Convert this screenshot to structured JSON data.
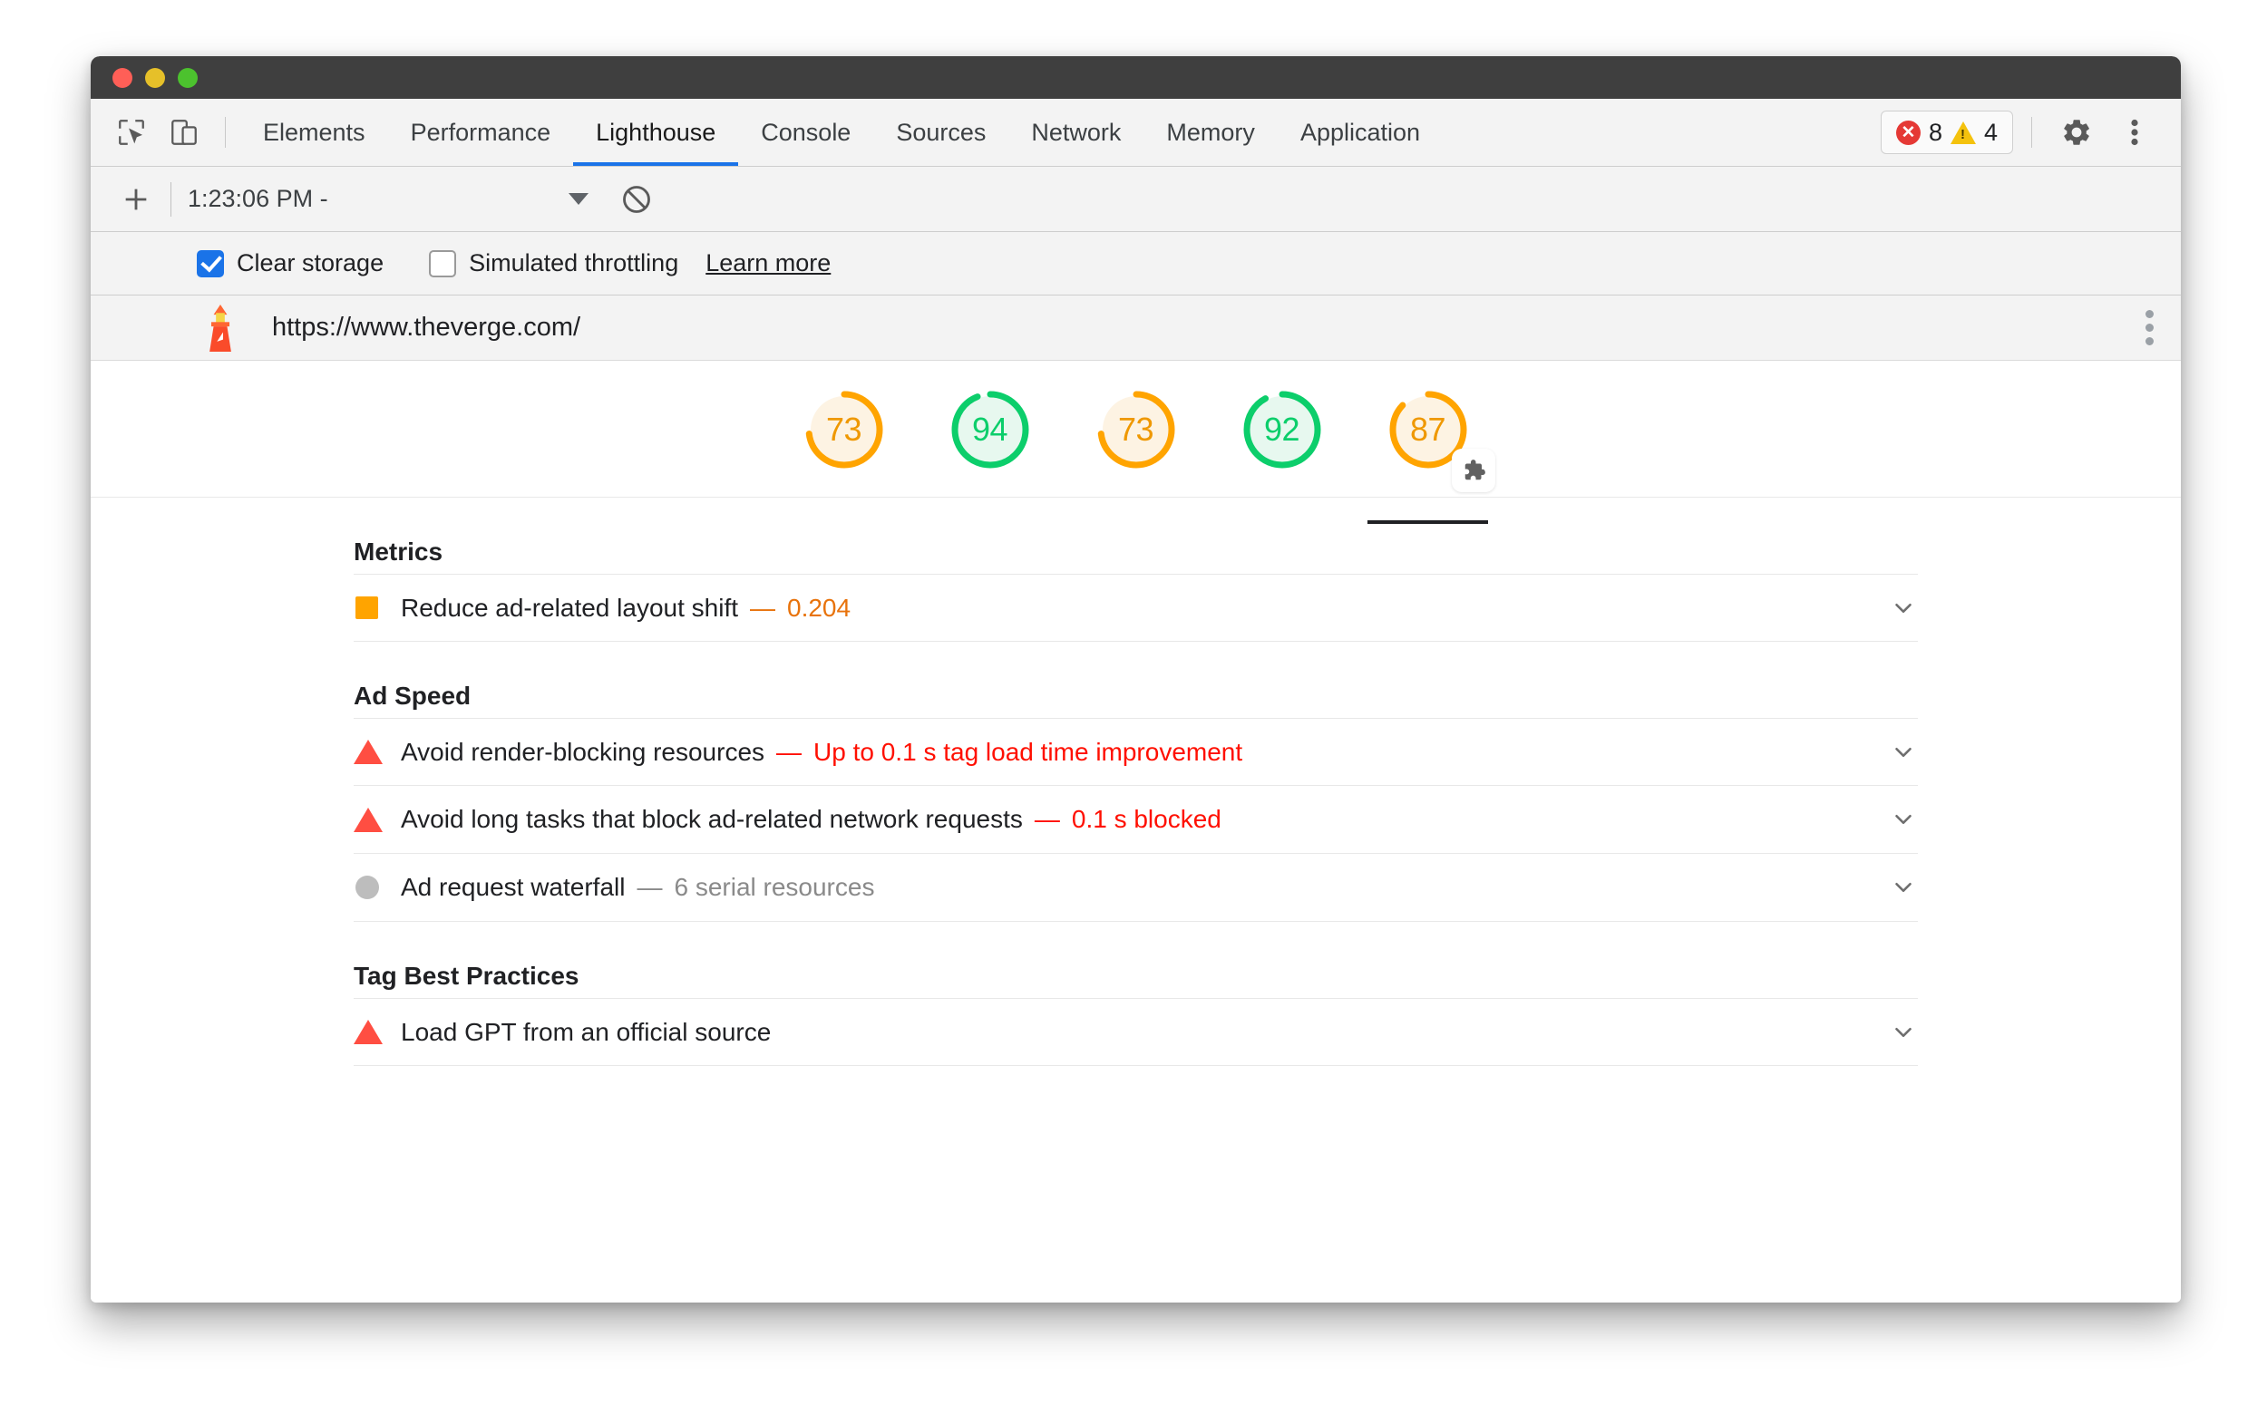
{
  "window": {
    "traffic_lights": [
      "close",
      "minimize",
      "maximize"
    ]
  },
  "devtools": {
    "toolbar_icons": [
      "inspect-element-icon",
      "device-toolbar-icon"
    ],
    "tabs": [
      {
        "label": "Elements",
        "active": false
      },
      {
        "label": "Performance",
        "active": false
      },
      {
        "label": "Lighthouse",
        "active": true
      },
      {
        "label": "Console",
        "active": false
      },
      {
        "label": "Sources",
        "active": false
      },
      {
        "label": "Network",
        "active": false
      },
      {
        "label": "Memory",
        "active": false
      },
      {
        "label": "Application",
        "active": false
      }
    ],
    "issues": {
      "error_count": "8",
      "warning_count": "4",
      "error_color": "#e53935",
      "warning_color": "#f4c20d"
    },
    "settings_icon": "gear-icon",
    "more_icon": "more-vertical-icon"
  },
  "runbar": {
    "add_label": "+",
    "report_selected": "1:23:06 PM -",
    "clear_icon": "clear-prohibited-icon"
  },
  "options": {
    "clear_storage": {
      "label": "Clear storage",
      "checked": true
    },
    "simulated_throttling": {
      "label": "Simulated throttling",
      "checked": false
    },
    "learn_more": "Learn more"
  },
  "url_header": {
    "logo_icon": "lighthouse-logo-icon",
    "url": "https://www.theverge.com/",
    "menu_icon": "more-vertical-icon"
  },
  "gauges": [
    {
      "score": "73",
      "status": "orange",
      "selected": false,
      "plugin": false
    },
    {
      "score": "94",
      "status": "green",
      "selected": false,
      "plugin": false
    },
    {
      "score": "73",
      "status": "orange",
      "selected": false,
      "plugin": false
    },
    {
      "score": "92",
      "status": "green",
      "selected": false,
      "plugin": false
    },
    {
      "score": "87",
      "status": "orange",
      "selected": true,
      "plugin": true
    }
  ],
  "colors": {
    "orange_stroke": "#ffa400",
    "orange_fill": "#fdf3e3",
    "green_stroke": "#0cce6b",
    "green_fill": "#e7f8ef",
    "accent_blue": "#1a73e8",
    "red": "#ff4e42"
  },
  "sections": [
    {
      "title": "Metrics",
      "audits": [
        {
          "icon": "square-warning-icon",
          "icon_kind": "square",
          "title": "Reduce ad-related layout shift",
          "dash": "—",
          "value": "0.204",
          "value_color": "orange",
          "chevron": "chevron-down-icon"
        }
      ]
    },
    {
      "title": "Ad Speed",
      "audits": [
        {
          "icon": "triangle-error-icon",
          "icon_kind": "triangle",
          "title": "Avoid render-blocking resources",
          "dash": "—",
          "value": "Up to 0.1 s tag load time improvement",
          "value_color": "red",
          "chevron": "chevron-down-icon"
        },
        {
          "icon": "triangle-error-icon",
          "icon_kind": "triangle",
          "title": "Avoid long tasks that block ad-related network requests",
          "dash": "—",
          "value": "0.1 s blocked",
          "value_color": "red",
          "chevron": "chevron-down-icon"
        },
        {
          "icon": "circle-info-icon",
          "icon_kind": "circle",
          "title": "Ad request waterfall",
          "dash": "—",
          "value": "6 serial resources",
          "value_color": "gray",
          "chevron": "chevron-down-icon"
        }
      ]
    },
    {
      "title": "Tag Best Practices",
      "audits": [
        {
          "icon": "triangle-error-icon",
          "icon_kind": "triangle",
          "title": "Load GPT from an official source",
          "dash": "",
          "value": "",
          "value_color": "red",
          "chevron": "chevron-down-icon"
        }
      ]
    }
  ]
}
